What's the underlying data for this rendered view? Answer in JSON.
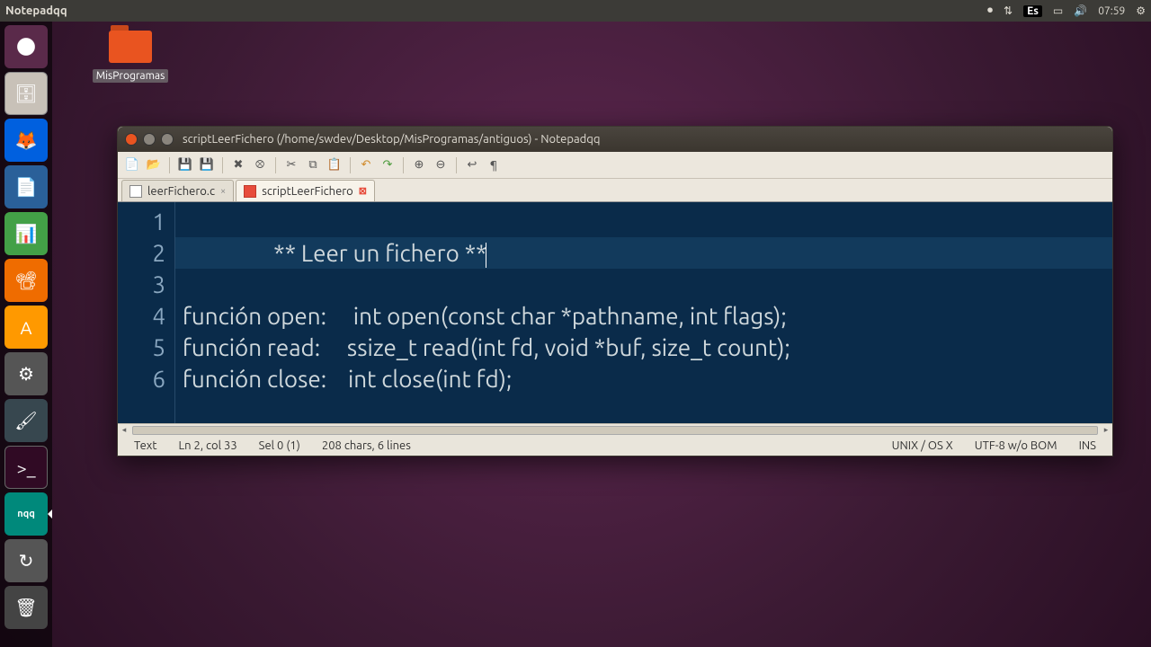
{
  "topbar": {
    "app": "Notepadqq",
    "lang": "Es",
    "time": "07:59"
  },
  "desktop": {
    "folder_label": "MisProgramas"
  },
  "window": {
    "title": "scriptLeerFichero (/home/swdev/Desktop/MisProgramas/antiguos) - Notepadqq"
  },
  "tabs": {
    "items": [
      {
        "name": "leerFichero.c",
        "active": false,
        "modified": false
      },
      {
        "name": "scriptLeerFichero",
        "active": true,
        "modified": true
      }
    ]
  },
  "editor": {
    "lines": [
      "",
      "                 ** Leer un fichero **",
      "",
      "función open:     int open(const char *pathname, int flags);",
      "función read:     ssize_t read(int fd, void *buf, size_t count);",
      "función close:    int close(int fd);"
    ],
    "current_line_index": 1
  },
  "status": {
    "type": "Text",
    "pos": "Ln 2, col 33",
    "sel": "Sel 0 (1)",
    "chars": "208 chars, 6 lines",
    "eol": "UNIX / OS X",
    "enc": "UTF-8 w/o BOM",
    "mode": "INS"
  },
  "launcher": {
    "nqq_label": "nqq"
  }
}
